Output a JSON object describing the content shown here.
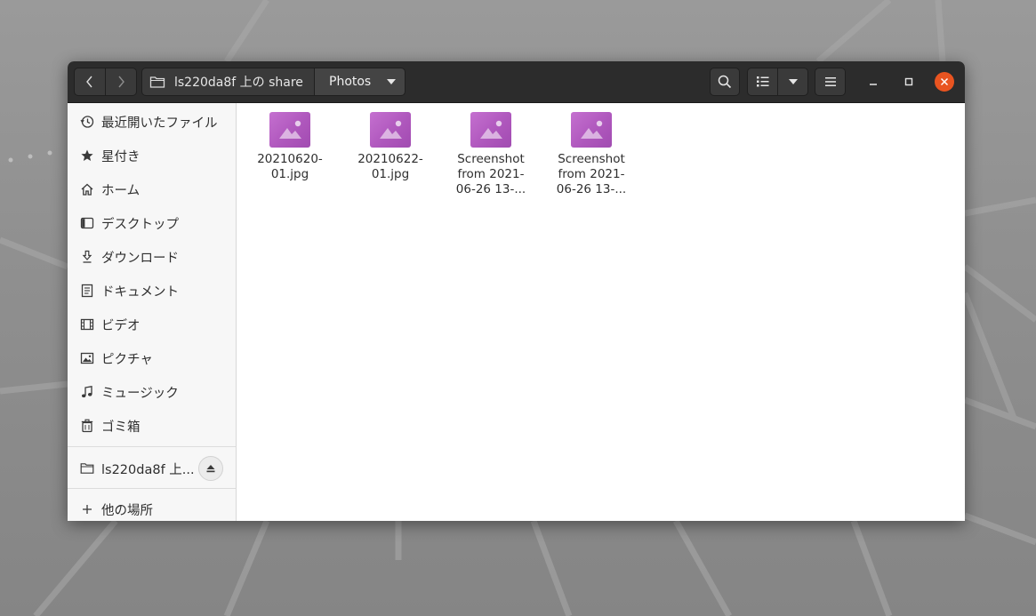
{
  "headerbar": {
    "path_share_label": "ls220da8f 上の share",
    "path_current_label": "Photos"
  },
  "icons": {
    "back": "chevron-left-icon",
    "forward": "chevron-right-icon",
    "folder": "folder-icon",
    "dropdown": "triangle-down-icon",
    "search": "search-icon",
    "list_view": "list-view-icon",
    "menu": "hamburger-menu-icon",
    "minimize": "minimize-icon",
    "maximize": "maximize-icon",
    "close": "close-icon"
  },
  "sidebar": {
    "items": [
      {
        "label": "最近開いたファイル",
        "icon": "recent-clock-icon"
      },
      {
        "label": "星付き",
        "icon": "star-icon"
      },
      {
        "label": "ホーム",
        "icon": "home-icon"
      },
      {
        "label": "デスクトップ",
        "icon": "desktop-icon"
      },
      {
        "label": "ダウンロード",
        "icon": "download-icon"
      },
      {
        "label": "ドキュメント",
        "icon": "document-icon"
      },
      {
        "label": "ビデオ",
        "icon": "video-icon"
      },
      {
        "label": "ピクチャ",
        "icon": "picture-icon"
      },
      {
        "label": "ミュージック",
        "icon": "music-icon"
      },
      {
        "label": "ゴミ箱",
        "icon": "trash-icon"
      }
    ],
    "network_item": {
      "label": "ls220da8f 上...",
      "icon": "network-folder-icon"
    },
    "other_locations": {
      "label": "他の場所",
      "icon": "plus-icon"
    }
  },
  "files": [
    {
      "lines": [
        "20210620-",
        "01.jpg"
      ]
    },
    {
      "lines": [
        "20210622-",
        "01.jpg"
      ]
    },
    {
      "lines": [
        "Screenshot",
        "from 2021-",
        "06-26 13-..."
      ]
    },
    {
      "lines": [
        "Screenshot",
        "from 2021-",
        "06-26 13-..."
      ]
    }
  ],
  "colors": {
    "headerbar": "#2c2c2c",
    "close_button": "#e95420",
    "image_icon": "#b04fbe"
  }
}
